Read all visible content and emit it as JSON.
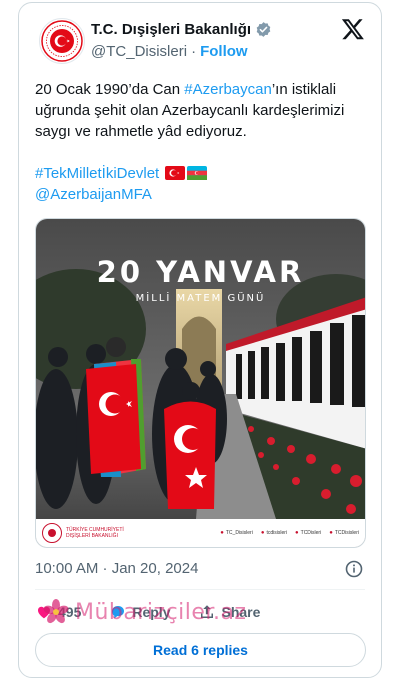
{
  "account": {
    "name": "T.C. Dışişleri Bakanlığı",
    "handle": "@TC_Disisleri",
    "separator": "·",
    "follow_label": "Follow",
    "verified": true
  },
  "tweet": {
    "line1": "20 Ocak 1990’da Can ",
    "hashtag_az": "#Azerbaycan",
    "line1_rest": "’ın istiklali uğrunda şehit olan Azerbaycanlı kardeşlerimizi saygı ve rahmetle yâd ediyoruz.",
    "hashtag_devlet": "#TekMilletİkiDevlet",
    "mention": "@AzerbaijanMFA"
  },
  "media": {
    "title": "20 YANVAR",
    "subtitle": "MİLLİ MATEM GÜNÜ",
    "footer_org": "TÜRKİYE CUMHURİYETİ DIŞİŞLERİ BAKANLIĞI",
    "footer_social": [
      "TC_Disisleri",
      "tcdisisleri",
      "TCDisleri",
      "TCDisisleri"
    ]
  },
  "timestamp": "10:00 AM · Jan 20, 2024",
  "actions": {
    "like_count": "495",
    "reply_label": "Reply",
    "share_label": "Share"
  },
  "watermark": "Mübarizçiler.az",
  "read_replies_label": "Read 6 replies",
  "colors": {
    "accent": "#1d9bf0",
    "text": "#0f1419",
    "muted": "#536471",
    "turkey_red": "#e30a17",
    "verified_gold": "#829aab"
  },
  "icons": [
    "verified-badge-icon",
    "x-logo-icon",
    "info-icon",
    "heart-icon",
    "reply-icon",
    "share-icon",
    "flower-icon"
  ]
}
